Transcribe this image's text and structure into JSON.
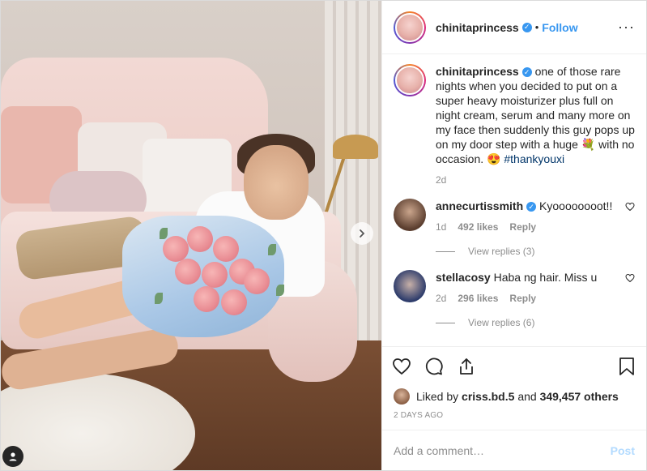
{
  "post": {
    "username": "chinitaprincess",
    "separator": "•",
    "follow_label": "Follow",
    "more_label": "···",
    "caption": "one of those rare nights when you decided to put on a super heavy moisturizer plus full on night cream, serum and many more on my face then suddenly this guy pops up on my door step with a huge",
    "caption_emoji": "💐",
    "caption_tail": "with no occasion.",
    "caption_emoji2": "😍",
    "hashtag": "#thankyouxi",
    "caption_time": "2d"
  },
  "comments": [
    {
      "username": "annecurtissmith",
      "verified": true,
      "text": "Kyoooooooot!!",
      "time": "1d",
      "likes": "492 likes",
      "reply_label": "Reply",
      "view_replies": "View replies (3)"
    },
    {
      "username": "stellacosy",
      "verified": false,
      "text": "Haba ng hair. Miss u",
      "time": "2d",
      "likes": "296 likes",
      "reply_label": "Reply",
      "view_replies": "View replies (6)"
    }
  ],
  "likes_line": {
    "prefix": "Liked by",
    "user": "criss.bd.5",
    "middle": "and",
    "count": "349,457 others"
  },
  "timestamp": "2 DAYS AGO",
  "add_comment": {
    "placeholder": "Add a comment…",
    "post_label": "Post"
  },
  "colors": {
    "link_blue": "#3897f0",
    "muted": "#8e8e8e",
    "text": "#262626",
    "post_disabled": "#b3dbff"
  },
  "icons": [
    "heart-icon",
    "comment-icon",
    "share-icon",
    "bookmark-icon",
    "chevron-right-icon",
    "user-tag-icon",
    "verified-badge-icon",
    "more-options-icon"
  ]
}
